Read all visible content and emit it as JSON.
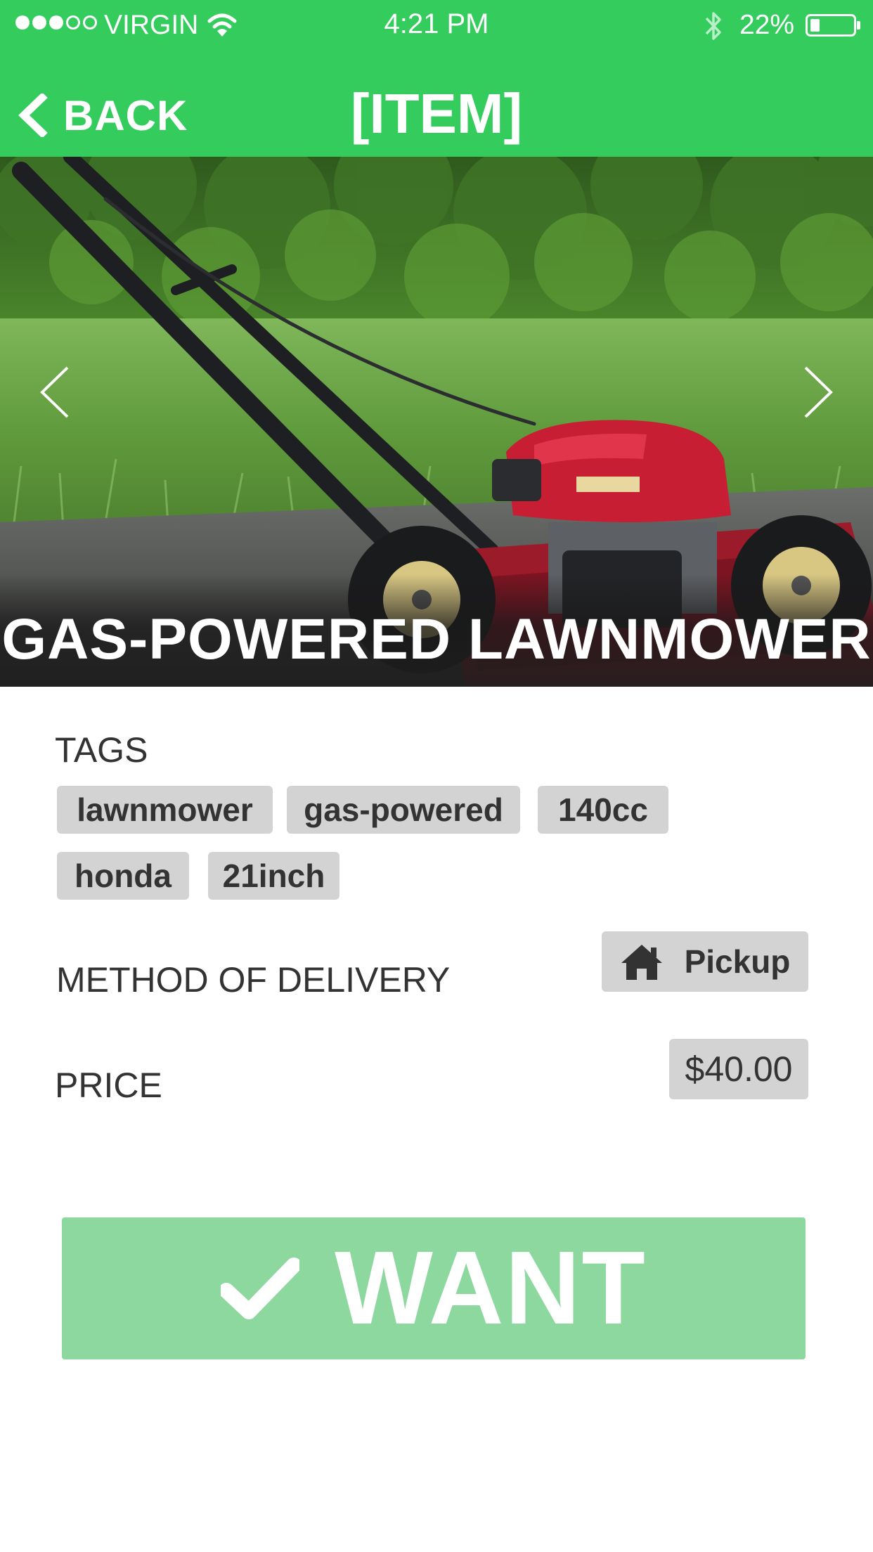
{
  "status_bar": {
    "carrier": "VIRGIN",
    "time": "4:21 PM",
    "battery_percent": "22%",
    "battery_level": 0.22,
    "signal_bars_filled": 3,
    "signal_bars_total": 5
  },
  "nav": {
    "back_label": "BACK",
    "title": "[ITEM]"
  },
  "hero": {
    "item_name": "GAS-POWERED LAWNMOWER",
    "prev_icon": "chevron-left-icon",
    "next_icon": "chevron-right-icon"
  },
  "details": {
    "tags_label": "TAGS",
    "tags": [
      "lawnmower",
      "gas-powered",
      "140cc",
      "honda",
      "21inch"
    ],
    "delivery_label": "METHOD OF DELIVERY",
    "delivery_value": "Pickup",
    "delivery_icon": "home-icon",
    "price_label": "PRICE",
    "price_value": "$40.00"
  },
  "action": {
    "want_label": "WANT",
    "want_icon": "checkmark-icon"
  },
  "colors": {
    "header_green": "#35cc5e",
    "want_button": "#8dd89f",
    "pill_gray": "#d3d3d3",
    "text_dark": "#333333"
  }
}
